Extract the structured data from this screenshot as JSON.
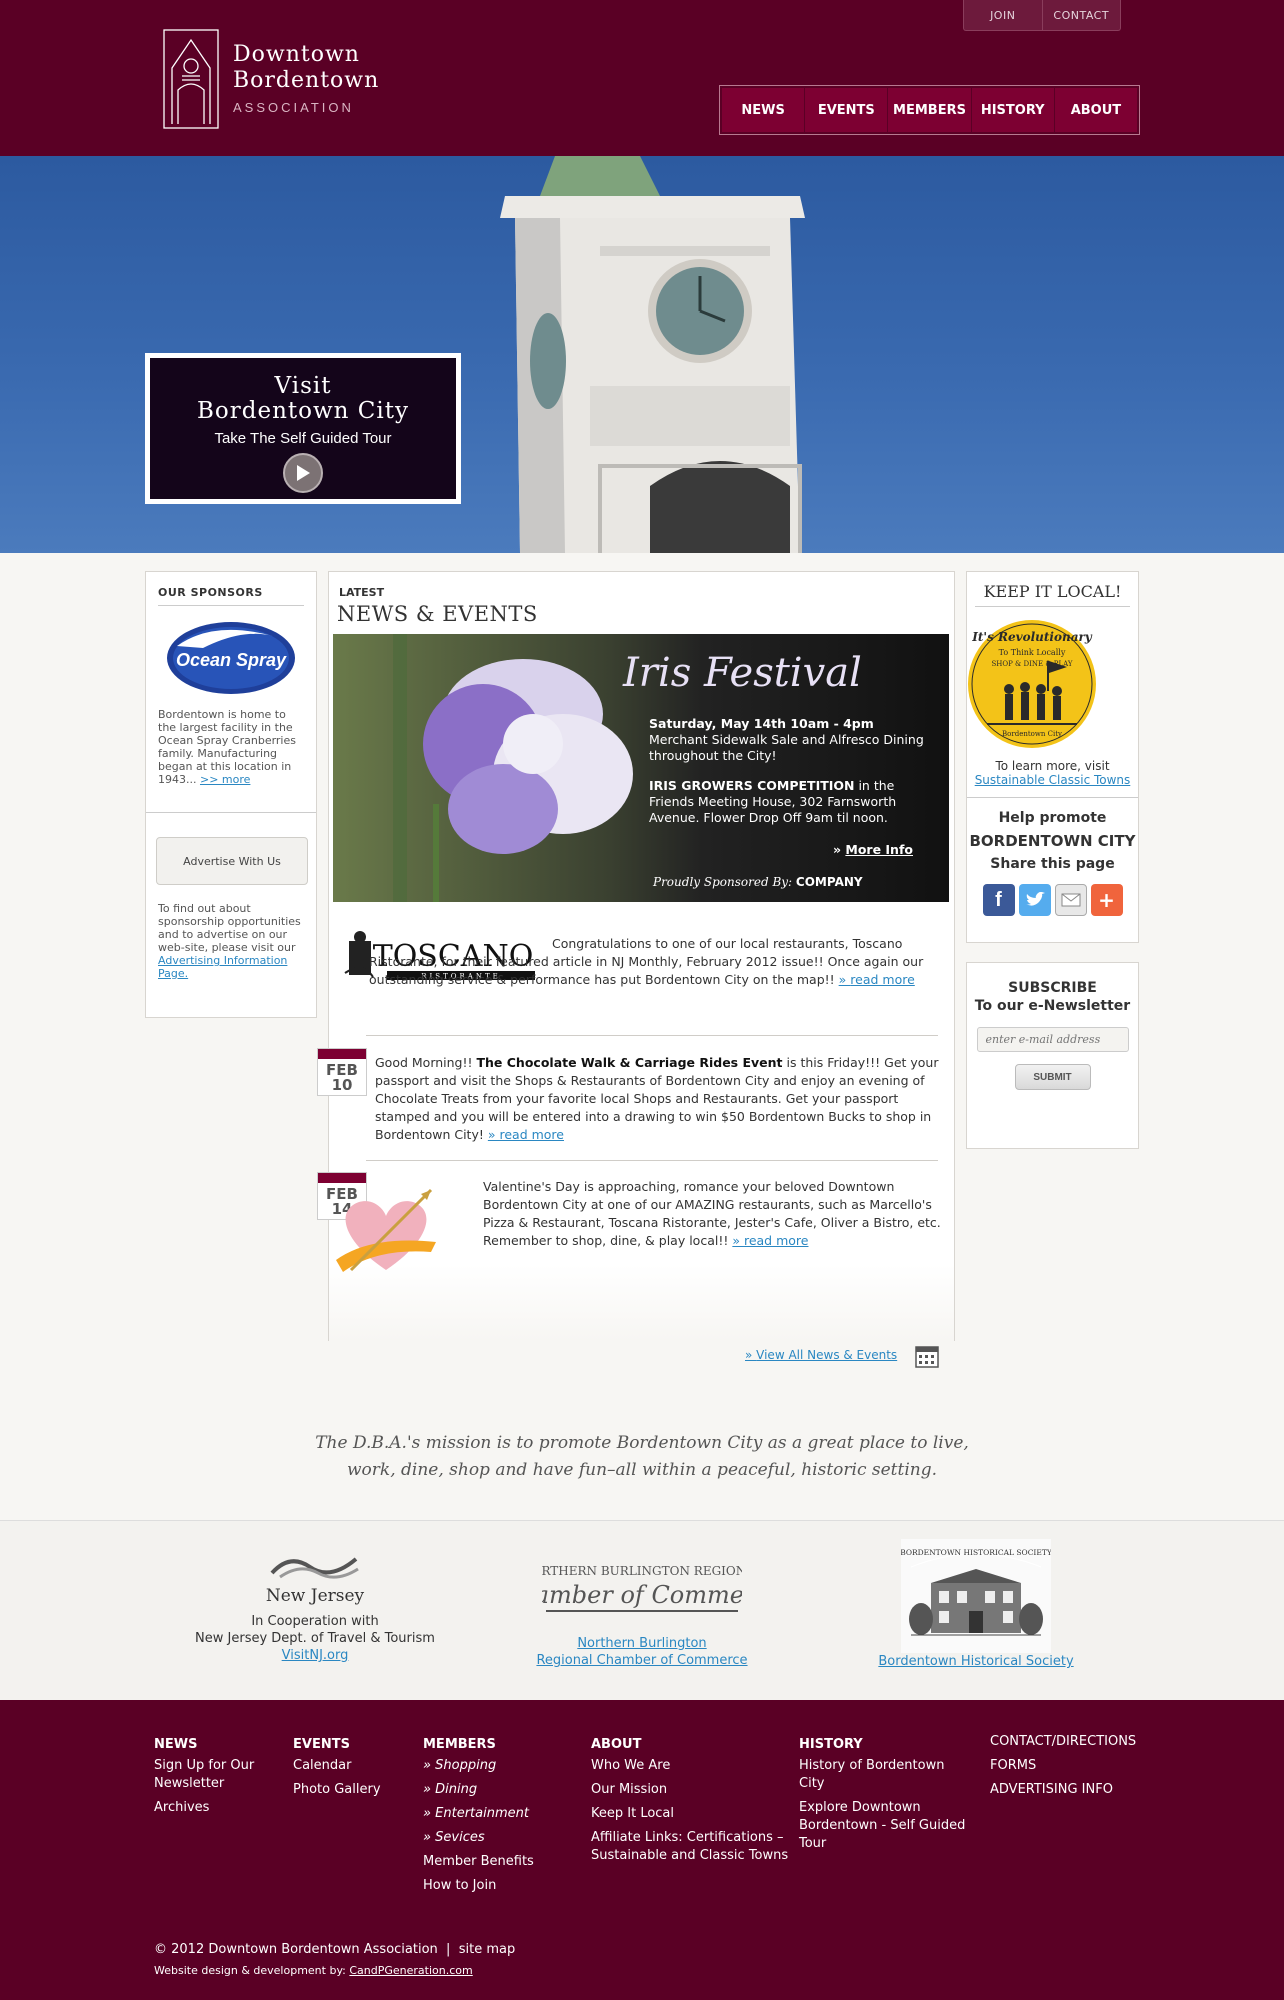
{
  "header": {
    "logo_line1": "Downtown",
    "logo_line2": "Bordentown",
    "logo_line3": "ASSOCIATION",
    "top_links": [
      "JOIN",
      "CONTACT"
    ],
    "nav": [
      "NEWS",
      "EVENTS",
      "MEMBERS",
      "HISTORY",
      "ABOUT"
    ]
  },
  "hero": {
    "title1": "Visit",
    "title2": "Bordentown City",
    "subtitle": "Take The Self Guided Tour"
  },
  "sponsors": {
    "heading": "OUR SPONSORS",
    "logo_text": "Ocean Spray",
    "text": "Bordentown is home to the largest facility in the Ocean Spray Cranberries family. Manufacturing began at this location in 1943...",
    "more_link": ">> more",
    "advertise_button": "Advertise With Us",
    "advertise_text": "To find out about sponsorship opportunities and to advertise on our web-site, please visit our",
    "advertise_link": "Advertising Information Page."
  },
  "news": {
    "label": "LATEST",
    "title": "NEWS & EVENTS",
    "featured": {
      "title": "Iris Festival",
      "date_line": "Saturday, May 14th 10am - 4pm",
      "line2": "Merchant Sidewalk Sale and Alfresco Dining throughout the City!",
      "competition_bold": "IRIS GROWERS COMPETITION",
      "competition_rest": " in the Friends Meeting House, 302 Farnsworth Avenue. Flower Drop Off 9am til noon.",
      "more_info": "More Info",
      "sponsored_by": "Proudly Sponsored By:",
      "sponsor": "COMPANY"
    },
    "items": [
      {
        "logo": "TOSCANO",
        "logo_sub": "RISTORANTE",
        "text": "Congratulations to one of our local restaurants, Toscano Ristorante, for their featured article in NJ Monthly, February 2012 issue!! Once again our outstanding service & performance has put Bordentown City on the map!!",
        "link": "read more"
      },
      {
        "month": "FEB",
        "day": "10",
        "text_before": "Good Morning!! ",
        "bold": "The Chocolate Walk & Carriage Rides Event",
        "text_after": " is this Friday!!! Get your passport and visit the Shops & Restaurants of Bordentown City and enjoy an evening of Chocolate Treats from your favorite local Shops and Restaurants. Get your passport stamped and you will be entered into a drawing to win $50 Bordentown Bucks to shop in Bordentown City!",
        "link": "read more"
      },
      {
        "month": "FEB",
        "day": "14",
        "text": "Valentine's Day is approaching, romance your beloved Downtown Bordentown City at one of our AMAZING restaurants, such as Marcello's Pizza & Restaurant, Toscana Ristorante, Jester's Cafe, Oliver a Bistro, etc. Remember to shop, dine, & play local!!",
        "link": "read more"
      }
    ],
    "view_all": "View All News & Events"
  },
  "keep_local": {
    "heading": "KEEP IT LOCAL!",
    "badge_line1": "It's Revolutionary",
    "badge_line2": "To Think Locally",
    "badge_line3": "SHOP & DINE & PLAY",
    "badge_line4": "Bordentown City",
    "learn_text": "To learn more, visit",
    "learn_link": "Sustainable Classic Towns",
    "promote1": "Help promote",
    "promote2": "BORDENTOWN CITY",
    "promote3": "Share this page"
  },
  "subscribe": {
    "line1": "SUBSCRIBE",
    "line2": "To our e-Newsletter",
    "placeholder": "enter e-mail address",
    "button": "SUBMIT"
  },
  "mission": {
    "line1": "The D.B.A.'s mission is to promote Bordentown City as a great place to live,",
    "line2": "work, dine, shop and have fun–all within a peaceful, historic setting."
  },
  "partners": [
    {
      "logo": "New Jersey",
      "line1": "In Cooperation with",
      "line2": "New Jersey Dept. of Travel & Tourism",
      "link": "VisitNJ.org"
    },
    {
      "logo1": "NORTHERN BURLINGTON REGIONAL",
      "logo2": "Chamber of Commerce",
      "link1": "Northern Burlington",
      "link2": "Regional Chamber of Commerce"
    },
    {
      "logo": "BORDENTOWN HISTORICAL SOCIETY",
      "link": "Bordentown Historical Society"
    }
  ],
  "footer": {
    "cols": [
      {
        "heading": "NEWS",
        "links": [
          "Sign Up for Our Newsletter",
          "Archives"
        ]
      },
      {
        "heading": "EVENTS",
        "links": [
          "Calendar",
          "Photo Gallery"
        ]
      },
      {
        "heading": "MEMBERS",
        "links": [
          "Shopping",
          "Dining",
          "Entertainment",
          "Sevices",
          "Member Benefits",
          "How to Join"
        ]
      },
      {
        "heading": "ABOUT",
        "links": [
          "Who We Are",
          "Our Mission",
          "Keep It Local",
          "Affiliate Links: Certifications – Sustainable and Classic Towns"
        ]
      },
      {
        "heading": "HISTORY",
        "links": [
          "History of Bordentown City",
          "Explore Downtown Bordentown - Self Guided Tour"
        ]
      },
      {
        "heading": "",
        "links": [
          "CONTACT/DIRECTIONS",
          "FORMS",
          "ADVERTISING INFO"
        ]
      }
    ],
    "copyright": "© 2012 Downtown Bordentown Association",
    "sitemap": "site map",
    "credit": "Website design & development by:",
    "credit_link": "CandPGeneration.com"
  },
  "colors": {
    "brand": "#5a0025",
    "nav": "#7d0032",
    "link": "#2a87c2",
    "sky": "#2c5aa0"
  }
}
